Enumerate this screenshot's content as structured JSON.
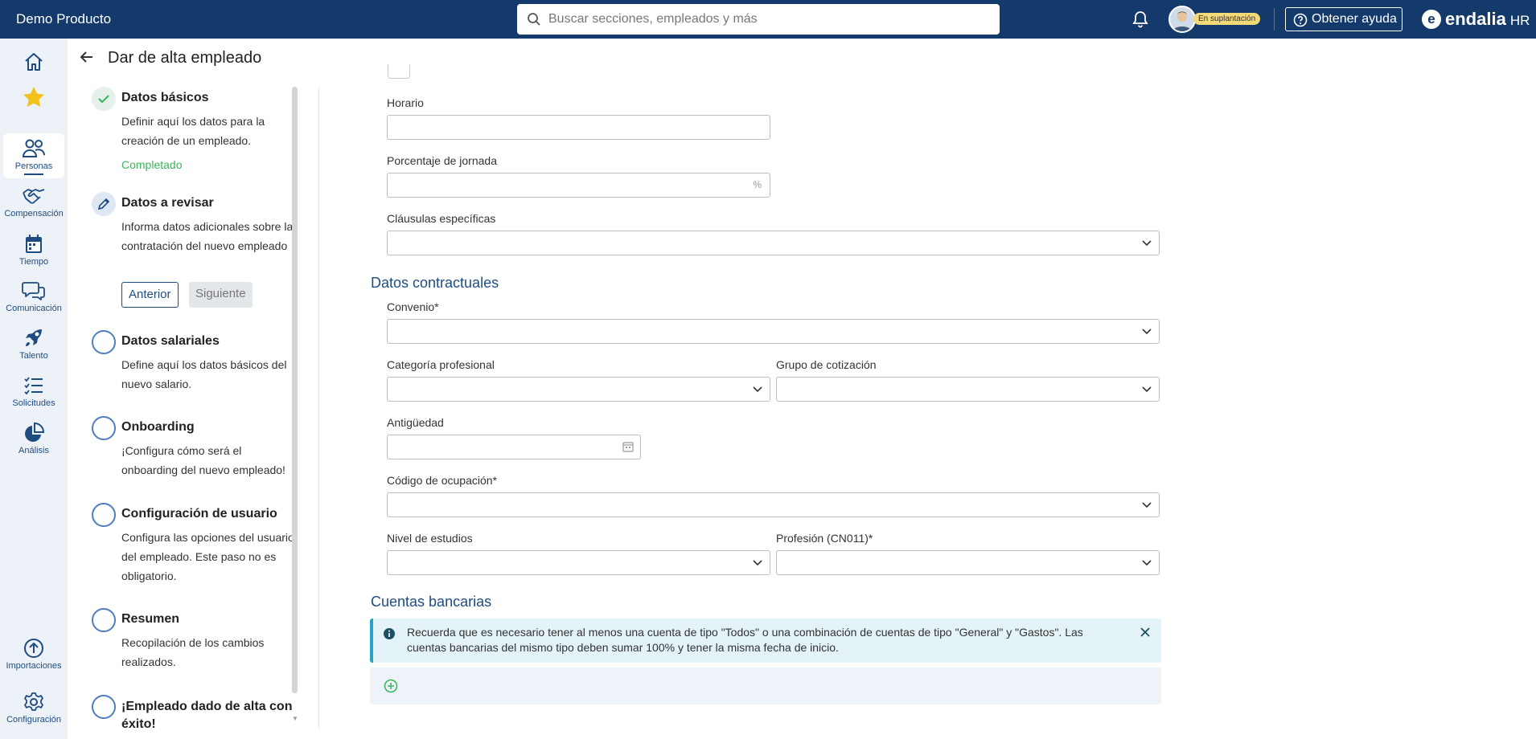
{
  "topbar": {
    "app_name": "Demo Producto",
    "search_placeholder": "Buscar secciones, empleados y más",
    "impersonation_badge": "En suplantación",
    "help_label": "Obtener ayuda",
    "logo_text": "endalia",
    "logo_suffix": "HR",
    "logo_mark": "e",
    "colors": {
      "bar": "#143a6b",
      "badge": "#f3d977"
    }
  },
  "sidebar": {
    "items": [
      {
        "label": "",
        "icon": "home-icon"
      },
      {
        "label": "",
        "icon": "star-icon"
      },
      {
        "label": "Personas",
        "icon": "people-icon",
        "active": true
      },
      {
        "label": "Compensación",
        "icon": "handshake-icon"
      },
      {
        "label": "Tiempo",
        "icon": "calendar-icon"
      },
      {
        "label": "Comunicación",
        "icon": "chat-icon"
      },
      {
        "label": "Talento",
        "icon": "rocket-icon"
      },
      {
        "label": "Solicitudes",
        "icon": "checklist-icon"
      },
      {
        "label": "Análisis",
        "icon": "pie-chart-icon"
      }
    ],
    "bottom": [
      {
        "label": "Importaciones",
        "icon": "upload-icon"
      },
      {
        "label": "Configuración",
        "icon": "gear-icon"
      }
    ]
  },
  "page": {
    "title": "Dar de alta empleado"
  },
  "stepper": {
    "steps": [
      {
        "title": "Datos básicos",
        "desc": "Definir aquí los datos para la creación de un empleado.",
        "status": "Completado",
        "state": "done"
      },
      {
        "title": "Datos a revisar",
        "desc": "Informa datos adicionales sobre la contratación del nuevo empleado",
        "state": "current"
      },
      {
        "title": "Datos salariales",
        "desc": "Define aquí los datos básicos del nuevo salario.",
        "state": "pending"
      },
      {
        "title": "Onboarding",
        "desc": "¡Configura cómo será el onboarding del nuevo empleado!",
        "state": "pending"
      },
      {
        "title": "Configuración de usuario",
        "desc": "Configura las opciones del usuario del empleado. Este paso no es obligatorio.",
        "state": "pending"
      },
      {
        "title": "Resumen",
        "desc": "Recopilación de los cambios realizados.",
        "state": "pending"
      },
      {
        "title": "¡Empleado dado de alta con éxito!",
        "desc": "",
        "state": "pending"
      }
    ],
    "prev_label": "Anterior",
    "next_label": "Siguiente"
  },
  "form": {
    "horario": {
      "label": "Horario",
      "value": ""
    },
    "porcentaje": {
      "label": "Porcentaje de jornada",
      "value": "",
      "suffix": "%"
    },
    "clausulas": {
      "label": "Cláusulas específicas",
      "value": ""
    },
    "section_contractual": "Datos contractuales",
    "convenio": {
      "label": "Convenio*",
      "value": ""
    },
    "categoria": {
      "label": "Categoría profesional",
      "value": ""
    },
    "grupo": {
      "label": "Grupo de cotización",
      "value": ""
    },
    "antiguedad": {
      "label": "Antigüedad",
      "value": ""
    },
    "codigo": {
      "label": "Código de ocupación*",
      "value": ""
    },
    "nivel": {
      "label": "Nivel de estudios",
      "value": ""
    },
    "profesion": {
      "label": "Profesión (CN011)*",
      "value": ""
    },
    "section_bank": "Cuentas bancarias",
    "bank_info": "Recuerda que es necesario tener al menos una cuenta de tipo \"Todos\" o una combinación de cuentas de tipo \"General\" y \"Gastos\". Las cuentas bancarias del mismo tipo deben sumar 100% y tener la misma fecha de inicio."
  }
}
